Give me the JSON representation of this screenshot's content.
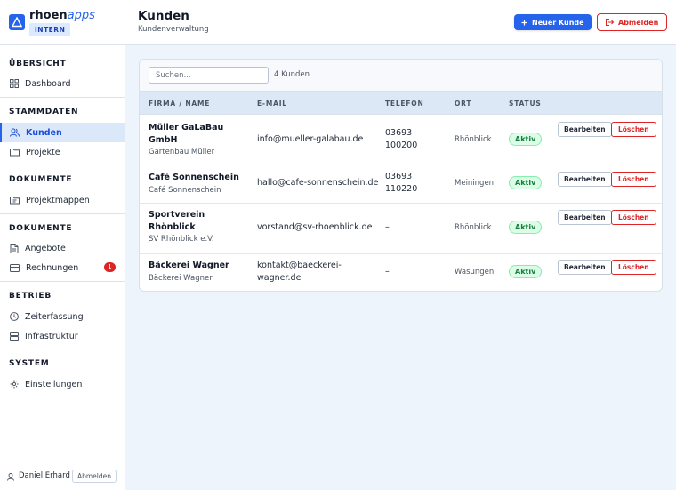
{
  "brand": {
    "name_main": "rhoen",
    "name_accent": "apps",
    "badge": "INTERN"
  },
  "sidebar": {
    "sections": [
      {
        "title": "ÜBERSICHT",
        "items": [
          {
            "label": "Dashboard",
            "icon": "grid-icon"
          }
        ]
      },
      {
        "title": "STAMMDATEN",
        "items": [
          {
            "label": "Kunden",
            "icon": "users-icon",
            "active": true
          },
          {
            "label": "Projekte",
            "icon": "folder-icon"
          }
        ]
      },
      {
        "title": "DOKUMENTE",
        "items": [
          {
            "label": "Projektmappen",
            "icon": "folder-file-icon"
          }
        ]
      },
      {
        "title": "DOKUMENTE",
        "items": [
          {
            "label": "Angebote",
            "icon": "document-icon"
          },
          {
            "label": "Rechnungen",
            "icon": "credit-card-icon",
            "badge": "1"
          }
        ]
      },
      {
        "title": "BETRIEB",
        "items": [
          {
            "label": "Zeiterfassung",
            "icon": "clock-icon"
          },
          {
            "label": "Infrastruktur",
            "icon": "server-icon"
          }
        ]
      },
      {
        "title": "SYSTEM",
        "items": [
          {
            "label": "Einstellungen",
            "icon": "gear-icon"
          }
        ]
      }
    ],
    "user": {
      "name": "Daniel Erhard",
      "logout_label": "Abmelden"
    }
  },
  "header": {
    "title": "Kunden",
    "subtitle": "Kundenverwaltung",
    "new_button": "Neuer Kunde",
    "logout_button": "Abmelden"
  },
  "table": {
    "search_placeholder": "Suchen...",
    "count": "4 Kunden",
    "columns": [
      "FIRMA / NAME",
      "E-MAIL",
      "TELEFON",
      "ORT",
      "STATUS"
    ],
    "rows": [
      {
        "name": [
          "Müller GaLaBau",
          "GmbH"
        ],
        "contact": "Gartenbau Müller",
        "email": [
          "info@mueller-galabau.de"
        ],
        "phone": [
          "03693",
          "100200"
        ],
        "city": "Rhönblick",
        "status": "Aktiv"
      },
      {
        "name": [
          "Café Sonnenschein"
        ],
        "contact": "Café Sonnenschein",
        "email": [
          "hallo@cafe-sonnenschein.de"
        ],
        "phone": [
          "03693",
          "110220"
        ],
        "city": "Meiningen",
        "status": "Aktiv"
      },
      {
        "name": [
          "Sportverein",
          "Rhönblick"
        ],
        "contact": "SV Rhönblick e.V.",
        "email": [
          "vorstand@sv-rhoenblick.de"
        ],
        "phone": [
          "–"
        ],
        "city": "Rhönblick",
        "status": "Aktiv"
      },
      {
        "name": [
          "Bäckerei Wagner"
        ],
        "contact": "Bäckerei Wagner",
        "email": [
          "kontakt@baeckerei-",
          "wagner.de"
        ],
        "phone": [
          "–"
        ],
        "city": "Wasungen",
        "status": "Aktiv"
      }
    ],
    "edit_label": "Bearbeiten",
    "delete_label": "Löschen"
  }
}
